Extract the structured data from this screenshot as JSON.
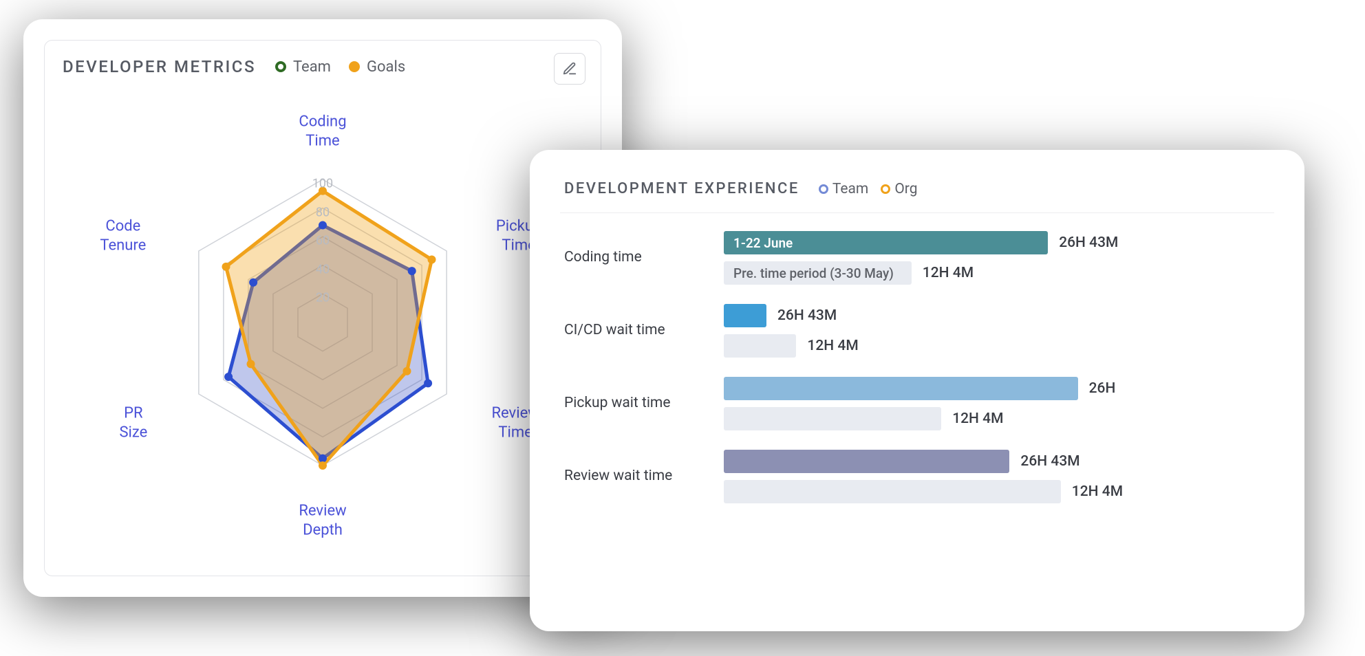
{
  "radar": {
    "title": "DEVELOPER METRICS",
    "legend": {
      "team": "Team",
      "goals": "Goals"
    },
    "colors": {
      "team": "#2c4ed0",
      "goals": "#f0a21b",
      "legend_ring": "#2f6b24"
    },
    "edit_tooltip": "Edit",
    "axes": [
      "Coding\nTime",
      "Pickup\nTime",
      "Review\nTime",
      "Review\nDepth",
      "PR\nSize",
      "Code\nTenure"
    ],
    "ticks": [
      "20",
      "40",
      "60",
      "80",
      "100"
    ],
    "series": {
      "team": [
        68,
        72,
        85,
        95,
        76,
        56
      ],
      "goals": [
        92,
        88,
        68,
        100,
        58,
        78
      ]
    }
  },
  "bars": {
    "title": "DEVELOPMENT EXPERIENCE",
    "legend": {
      "team": "Team",
      "org": "Org"
    },
    "period_current": "1-22 June",
    "period_previous": "Pre. time period (3-30 May)",
    "rows": [
      {
        "label": "Coding time",
        "current": {
          "text": "26H 43M",
          "width": 0.76,
          "color": "c-teal",
          "inner_first": true
        },
        "previous": {
          "text": "12H 4M",
          "width": 0.44,
          "color": "c-ltgrey",
          "inner_first": true
        }
      },
      {
        "label": "CI/CD wait time",
        "current": {
          "text": "26H 43M",
          "width": 0.1,
          "color": "c-blue"
        },
        "previous": {
          "text": "12H 4M",
          "width": 0.17,
          "color": "c-ltgrey"
        }
      },
      {
        "label": "Pickup wait time",
        "current": {
          "text": "26H",
          "width": 0.83,
          "color": "c-ltblue"
        },
        "previous": {
          "text": "12H 4M",
          "width": 0.51,
          "color": "c-ltgrey"
        }
      },
      {
        "label": "Review wait time",
        "current": {
          "text": "26H 43M",
          "width": 0.67,
          "color": "c-purplegrey"
        },
        "previous": {
          "text": "12H 4M",
          "width": 0.79,
          "color": "c-ltgrey"
        }
      }
    ]
  },
  "chart_data": [
    {
      "type": "radar",
      "title": "Developer Metrics",
      "axes": [
        "Coding Time",
        "Pickup Time",
        "Review Time",
        "Review Depth",
        "PR Size",
        "Code Tenure"
      ],
      "range": [
        0,
        100
      ],
      "ticks": [
        20,
        40,
        60,
        80,
        100
      ],
      "series": [
        {
          "name": "Team",
          "color": "#2c4ed0",
          "values": [
            68,
            72,
            85,
            95,
            76,
            56
          ]
        },
        {
          "name": "Goals",
          "color": "#f0a21b",
          "values": [
            92,
            88,
            68,
            100,
            58,
            78
          ]
        }
      ],
      "legend_position": "top-left"
    },
    {
      "type": "bar",
      "title": "Development Experience",
      "orientation": "horizontal",
      "categories": [
        "Coding time",
        "CI/CD wait time",
        "Pickup wait time",
        "Review wait time"
      ],
      "series": [
        {
          "name": "1-22 June (Team)",
          "values_label": [
            "26H 43M",
            "26H 43M",
            "26H",
            "26H 43M"
          ],
          "values_rel": [
            0.76,
            0.1,
            0.83,
            0.67
          ]
        },
        {
          "name": "Pre. time period (3-30 May) (Org)",
          "values_label": [
            "12H 4M",
            "12H 4M",
            "12H 4M",
            "12H 4M"
          ],
          "values_rel": [
            0.44,
            0.17,
            0.51,
            0.79
          ]
        }
      ],
      "legend": [
        "Team",
        "Org"
      ],
      "legend_position": "top-right"
    }
  ]
}
